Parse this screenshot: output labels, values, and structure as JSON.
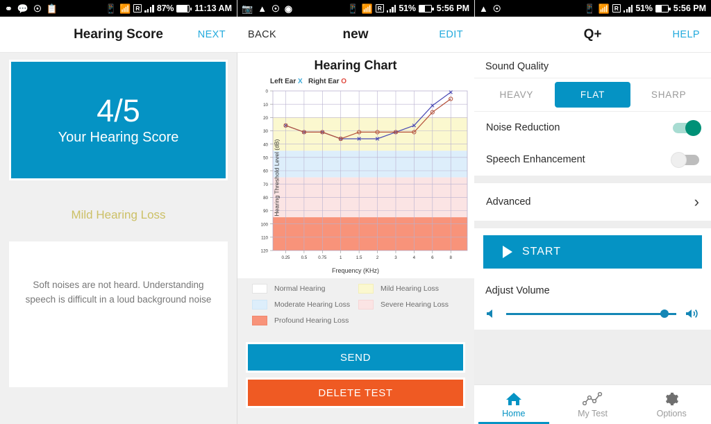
{
  "panes": [
    {
      "status": {
        "icons": [
          "headphones-icon",
          "chat-icon",
          "update-icon",
          "clipboard-check-icon"
        ],
        "battery_pct": "87%",
        "time": "11:13 AM",
        "roaming": "R"
      },
      "appbar": {
        "title": "Hearing Score",
        "right_action": "NEXT"
      }
    },
    {
      "status": {
        "icons": [
          "photo-icon",
          "drive-icon",
          "update-icon",
          "messenger-icon"
        ],
        "battery_pct": "51%",
        "time": "5:56 PM",
        "roaming": "R"
      },
      "appbar": {
        "left_action": "BACK",
        "title": "new",
        "right_action": "EDIT"
      }
    },
    {
      "status": {
        "icons": [
          "drive-icon",
          "update-icon"
        ],
        "battery_pct": "51%",
        "time": "5:56 PM",
        "roaming": "R"
      },
      "appbar": {
        "title": "Q+",
        "right_action": "HELP"
      }
    }
  ],
  "left": {
    "score_value": "4/5",
    "score_caption": "Your Hearing Score",
    "loss_label": "Mild Hearing Loss",
    "description": "Soft noises are not heard. Understanding speech is difficult in a loud background noise",
    "colors": {
      "card": "#0593c4",
      "loss_text": "#ccc066"
    }
  },
  "mid": {
    "ear_key": {
      "left_label": "Left Ear",
      "left_mark": "X",
      "right_label": "Right Ear",
      "right_mark": "O"
    },
    "legend": [
      {
        "label": "Normal Hearing",
        "color": "#ffffff"
      },
      {
        "label": "Mild Hearing Loss",
        "color": "#fbf8cf"
      },
      {
        "label": "Moderate Hearing Loss",
        "color": "#ddeefb"
      },
      {
        "label": "Severe Hearing Loss",
        "color": "#fbe4e4"
      },
      {
        "label": "Profound Hearing Loss",
        "color": "#f8937a"
      }
    ],
    "send_label": "SEND",
    "delete_label": "DELETE TEST"
  },
  "chart_data": {
    "type": "line",
    "title": "Hearing Chart",
    "xlabel": "Frequency (KHz)",
    "ylabel": "Hearing Threshold Level (dB)",
    "x": [
      0.25,
      0.5,
      0.75,
      1,
      1.5,
      2,
      3,
      4,
      6,
      8
    ],
    "xtick_labels": [
      "0.25",
      "0.5",
      "0.75",
      "1",
      "1.5",
      "2",
      "3",
      "4",
      "6",
      "8"
    ],
    "ytick_labels": [
      "0",
      "10",
      "20",
      "30",
      "40",
      "50",
      "60",
      "70",
      "80",
      "90",
      "100",
      "110",
      "120"
    ],
    "ylim": [
      0,
      120
    ],
    "y_inverted": true,
    "grid": true,
    "series": [
      {
        "name": "Left Ear",
        "marker": "X",
        "color": "#4a4ab4",
        "values": [
          26,
          31,
          31,
          36,
          36,
          36,
          31,
          26,
          11,
          1
        ]
      },
      {
        "name": "Right Ear",
        "marker": "O",
        "color": "#b5533c",
        "values": [
          26,
          31,
          31,
          36,
          31,
          31,
          31,
          31,
          16,
          6
        ]
      }
    ],
    "bands": [
      {
        "label": "Normal Hearing",
        "from": 0,
        "to": 20,
        "color": "#ffffff"
      },
      {
        "label": "Mild Hearing Loss",
        "from": 20,
        "to": 45,
        "color": "#fbf8cf"
      },
      {
        "label": "Moderate Hearing Loss",
        "from": 45,
        "to": 65,
        "color": "#ddeefb"
      },
      {
        "label": "Severe Hearing Loss",
        "from": 65,
        "to": 95,
        "color": "#fbe4e4"
      },
      {
        "label": "Profound Hearing Loss",
        "from": 95,
        "to": 120,
        "color": "#f8937a"
      }
    ]
  },
  "right": {
    "sound_quality_title": "Sound Quality",
    "segments": [
      {
        "label": "HEAVY",
        "active": false
      },
      {
        "label": "FLAT",
        "active": true
      },
      {
        "label": "SHARP",
        "active": false
      }
    ],
    "toggles": [
      {
        "label": "Noise Reduction",
        "on": true
      },
      {
        "label": "Speech Enhancement",
        "on": false
      }
    ],
    "advanced_label": "Advanced",
    "start_label": "START",
    "volume_title": "Adjust Volume",
    "volume_percent": 93,
    "nav": [
      {
        "label": "Home",
        "icon": "home-icon",
        "active": true
      },
      {
        "label": "My Test",
        "icon": "chart-line-icon",
        "active": false
      },
      {
        "label": "Options",
        "icon": "gear-icon",
        "active": false
      }
    ],
    "colors": {
      "accent": "#0593c4",
      "toggle_on": "#009177"
    }
  }
}
